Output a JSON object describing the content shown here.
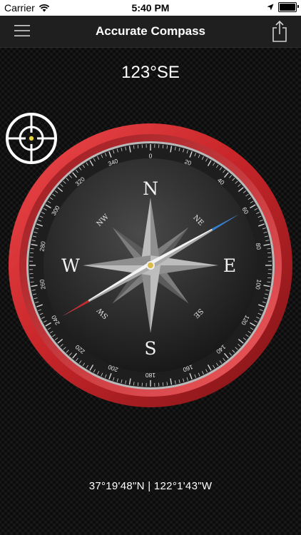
{
  "status_bar": {
    "carrier": "Carrier",
    "time": "5:40 PM"
  },
  "nav": {
    "title": "Accurate Compass"
  },
  "heading": "123°SE",
  "coordinates": "37°19'48\"N | 122°1'43\"W",
  "compass": {
    "cardinals": {
      "n": "N",
      "e": "E",
      "s": "S",
      "w": "W"
    },
    "intercardinals": {
      "ne": "NE",
      "se": "SE",
      "sw": "SW",
      "nw": "NW"
    },
    "degree_labels": [
      "0",
      "20",
      "40",
      "60",
      "80",
      "100",
      "120",
      "140",
      "160",
      "180",
      "200",
      "220",
      "240",
      "260",
      "280",
      "300",
      "320",
      "340"
    ],
    "needle_heading_deg": 60,
    "colors": {
      "bezel": "#d12a2e",
      "needle_blue": "#2f7fd6",
      "needle_red": "#c8262a",
      "hub": "#d9b948"
    }
  },
  "icons": {
    "menu": "hamburger-menu-icon",
    "share": "share-icon",
    "target": "crosshair-target-icon",
    "wifi": "wifi-icon",
    "location": "location-arrow-icon",
    "battery": "battery-icon"
  }
}
